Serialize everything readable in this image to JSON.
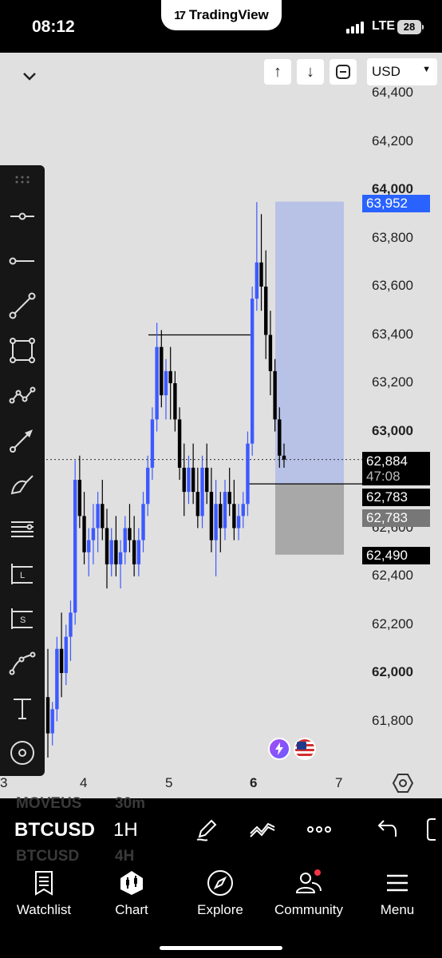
{
  "status_bar": {
    "time": "08:12",
    "app_name": "TradingView",
    "network": "LTE",
    "battery": "28"
  },
  "chart_header": {
    "buttons": [
      "↑",
      "↓"
    ],
    "currency": "USD"
  },
  "chart_data": {
    "type": "candlestick",
    "symbol": "BTCUSD",
    "interval": "1H",
    "y_axis_labels": [
      "64,400",
      "64,200",
      "64,000",
      "63,800",
      "63,600",
      "63,400",
      "63,200",
      "63,000",
      "62,600",
      "62,400",
      "62,200",
      "62,000",
      "61,800"
    ],
    "bold_y_labels": [
      "64,000",
      "63,000",
      "62,000"
    ],
    "ylim": [
      61700,
      64450
    ],
    "x_axis_labels": [
      "3",
      "4",
      "5",
      "6",
      "7"
    ],
    "last_price": "62,884",
    "countdown": "47:08",
    "position_tool": {
      "target": "63,952",
      "entry": "62,783",
      "entry_alt": "62,783",
      "stop": "62,490"
    },
    "candles": [
      [
        61900,
        62100,
        61650,
        61750
      ],
      [
        61750,
        61880,
        61700,
        61850
      ],
      [
        61850,
        62150,
        61800,
        62100
      ],
      [
        62100,
        62250,
        61900,
        62000
      ],
      [
        62000,
        62200,
        61950,
        62150
      ],
      [
        62150,
        62300,
        62050,
        62250
      ],
      [
        62250,
        62880,
        62200,
        62800
      ],
      [
        62800,
        62900,
        62600,
        62650
      ],
      [
        62650,
        62750,
        62450,
        62500
      ],
      [
        62500,
        62600,
        62400,
        62550
      ],
      [
        62550,
        62700,
        62450,
        62600
      ],
      [
        62600,
        62750,
        62500,
        62700
      ],
      [
        62700,
        62800,
        62550,
        62600
      ],
      [
        62600,
        62680,
        62350,
        62450
      ],
      [
        62450,
        62600,
        62400,
        62550
      ],
      [
        62550,
        62650,
        62400,
        62450
      ],
      [
        62450,
        62550,
        62350,
        62500
      ],
      [
        62500,
        62650,
        62450,
        62600
      ],
      [
        62600,
        62700,
        62500,
        62550
      ],
      [
        62550,
        62650,
        62400,
        62450
      ],
      [
        62450,
        62600,
        62400,
        62550
      ],
      [
        62550,
        62750,
        62500,
        62700
      ],
      [
        62700,
        62900,
        62650,
        62850
      ],
      [
        62850,
        63100,
        62800,
        63050
      ],
      [
        63050,
        63450,
        63000,
        63350
      ],
      [
        63350,
        63420,
        63100,
        63150
      ],
      [
        63150,
        63300,
        63050,
        63250
      ],
      [
        63250,
        63350,
        63050,
        63200
      ],
      [
        63200,
        63250,
        63000,
        63050
      ],
      [
        63050,
        63100,
        62800,
        62850
      ],
      [
        62850,
        62950,
        62650,
        62750
      ],
      [
        62750,
        62900,
        62700,
        62850
      ],
      [
        62850,
        62950,
        62700,
        62750
      ],
      [
        62750,
        62850,
        62600,
        62650
      ],
      [
        62650,
        62900,
        62600,
        62850
      ],
      [
        62850,
        62950,
        62700,
        62750
      ],
      [
        62750,
        62850,
        62500,
        62550
      ],
      [
        62550,
        62800,
        62400,
        62700
      ],
      [
        62700,
        62750,
        62500,
        62600
      ],
      [
        62600,
        62800,
        62550,
        62750
      ],
      [
        62750,
        62850,
        62650,
        62700
      ],
      [
        62700,
        62800,
        62550,
        62600
      ],
      [
        62600,
        62700,
        62550,
        62650
      ],
      [
        62650,
        62750,
        62600,
        62700
      ],
      [
        62700,
        63000,
        62650,
        62950
      ],
      [
        62950,
        63600,
        62900,
        63550
      ],
      [
        63550,
        63950,
        63500,
        63700
      ],
      [
        63700,
        63900,
        63500,
        63600
      ],
      [
        63600,
        63750,
        63300,
        63400
      ],
      [
        63400,
        63500,
        63150,
        63250
      ],
      [
        63250,
        63300,
        63000,
        63050
      ],
      [
        63050,
        63100,
        62850,
        62900
      ],
      [
        62900,
        62950,
        62850,
        62884
      ]
    ]
  },
  "bottom_bar": {
    "symbol": "BTCUSD",
    "interval": "1H",
    "ghost_symbol_1": "MOVEUS",
    "ghost_interval_1": "30m",
    "ghost_symbol_2": "BTCUSD",
    "ghost_interval_2": "4H"
  },
  "tabs": [
    {
      "label": "Watchlist",
      "icon": "watchlist-icon"
    },
    {
      "label": "Chart",
      "icon": "chart-icon"
    },
    {
      "label": "Explore",
      "icon": "compass-icon"
    },
    {
      "label": "Community",
      "icon": "community-icon"
    },
    {
      "label": "Menu",
      "icon": "menu-icon"
    }
  ],
  "colors": {
    "up": "#3d5afe",
    "down": "#000000",
    "target_zone": "#b8c2e6",
    "stop_zone": "#a8a8a8",
    "chart_bg": "#e0e0e0",
    "target_tag": "#2962ff"
  }
}
